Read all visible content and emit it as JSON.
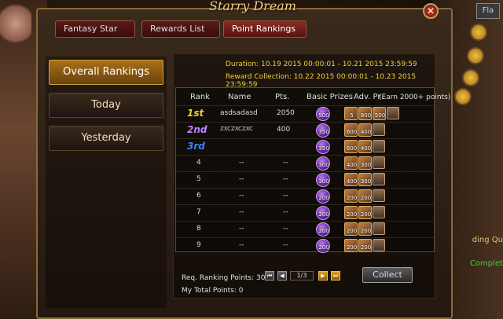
{
  "window": {
    "title": "Starry Dream",
    "close_symbol": "✕"
  },
  "tabs": [
    {
      "label": "Fantasy Star"
    },
    {
      "label": "Rewards List"
    },
    {
      "label": "Point Rankings",
      "active": true
    }
  ],
  "leftnav": [
    {
      "label": "Overall Rankings",
      "active": true
    },
    {
      "label": "Today"
    },
    {
      "label": "Yesterday"
    }
  ],
  "info": {
    "duration": "Duration: 10.19 2015 00:00:01 - 10.21 2015 23:59:59",
    "reward_collection": "Reward Collection: 10.22 2015 00:00:01 - 10.23 2015 23:59:59"
  },
  "table": {
    "headers": {
      "rank": "Rank",
      "name": "Name",
      "pts": "Pts.",
      "basic": "Basic Prizes",
      "adv": "Adv. Pr",
      "adv_note": "(Earn 2000+ points)"
    },
    "rows": [
      {
        "rank": "1st",
        "name": "asdsadasd",
        "pts": "2050",
        "basic": "500",
        "adv": [
          "5",
          "800",
          "500"
        ]
      },
      {
        "rank": "2nd",
        "name": "ZXCZXCZXC",
        "pts": "400",
        "basic": "350",
        "adv": [
          "600",
          "400"
        ]
      },
      {
        "rank": "3rd",
        "name": "",
        "pts": "",
        "basic": "350",
        "adv": [
          "600",
          "400"
        ]
      },
      {
        "rank": "4",
        "name": "--",
        "pts": "--",
        "basic": "300",
        "adv": [
          "400",
          "300"
        ]
      },
      {
        "rank": "5",
        "name": "--",
        "pts": "--",
        "basic": "300",
        "adv": [
          "400",
          "300"
        ]
      },
      {
        "rank": "6",
        "name": "--",
        "pts": "--",
        "basic": "200",
        "adv": [
          "200",
          "200"
        ]
      },
      {
        "rank": "7",
        "name": "--",
        "pts": "--",
        "basic": "200",
        "adv": [
          "200",
          "200"
        ]
      },
      {
        "rank": "8",
        "name": "--",
        "pts": "--",
        "basic": "200",
        "adv": [
          "200",
          "200"
        ]
      },
      {
        "rank": "9",
        "name": "--",
        "pts": "--",
        "basic": "200",
        "adv": [
          "200",
          "200"
        ]
      }
    ]
  },
  "footer": {
    "req": "Req. Ranking Points: 300",
    "total": "My Total Points: 0",
    "page": "1/3",
    "collect": "Collect"
  },
  "sidebar_right": {
    "tab": "Fla",
    "quest_text": "ding Qu",
    "complete_text": "Complet"
  },
  "colors": {
    "rank1": "#f0d020",
    "rank2": "#c080ff",
    "rank3": "#4080ff",
    "accent": "#f0d040"
  }
}
